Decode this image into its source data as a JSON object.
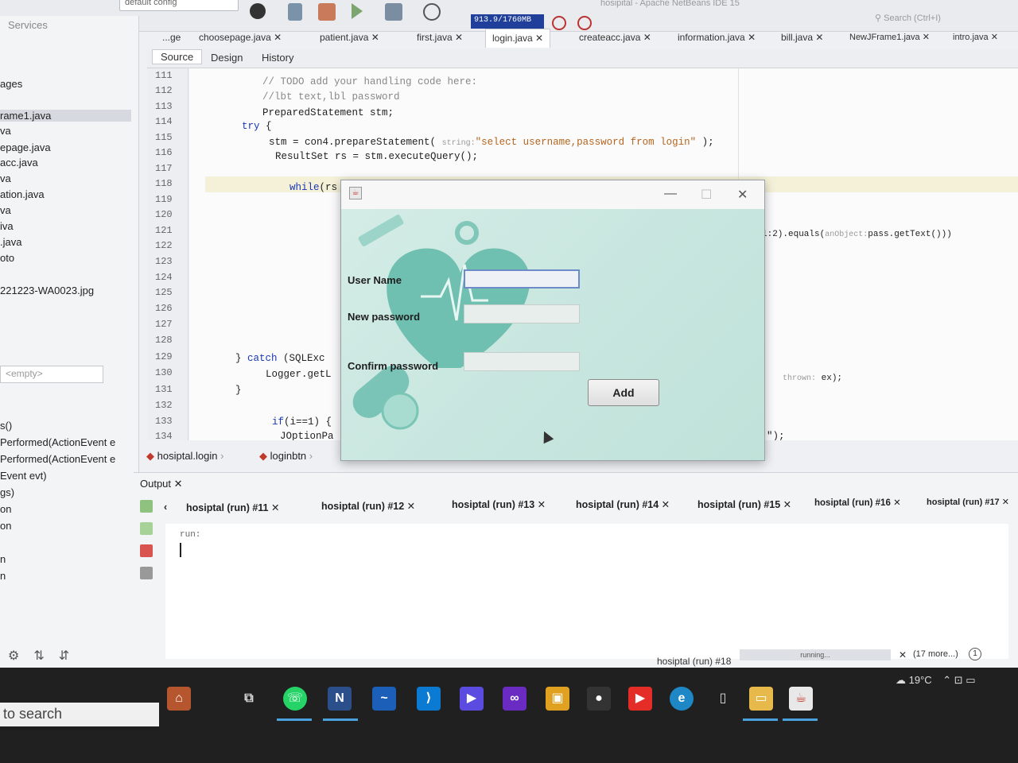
{
  "toolbar": {
    "config_select": "default config",
    "memory": "913.9/1760MB",
    "app_title": "hosipital - Apache NetBeans IDE 15",
    "search_placeholder": "Search (Ctrl+I)"
  },
  "left_panel": {
    "services": "Services",
    "items": [
      "ages",
      "rame1.java",
      "va",
      "epage.java",
      "acc.java",
      "va",
      "ation.java",
      "va",
      "iva",
      ".java",
      "oto",
      "221223-WA0023.jpg"
    ],
    "navigator_select": "<empty>",
    "members": [
      "s()",
      "Performed(ActionEvent e",
      "Performed(ActionEvent e",
      "Event evt)",
      "gs)",
      "on",
      "on",
      "n",
      "n"
    ]
  },
  "editor": {
    "tabs": [
      "...ge",
      "choosepage.java",
      "patient.java",
      "first.java",
      "login.java",
      "createacc.java",
      "information.java",
      "bill.java",
      "NewJFrame1.java",
      "intro.java"
    ],
    "active_tab": "login.java",
    "view_tabs": [
      "Source",
      "Design",
      "History"
    ],
    "line_numbers": [
      "111",
      "112",
      "113",
      "114",
      "115",
      "116",
      "117",
      "118",
      "119",
      "120",
      "121",
      "122",
      "123",
      "124",
      "125",
      "126",
      "127",
      "128",
      "129",
      "130",
      "131",
      "132",
      "133",
      "134"
    ],
    "code": {
      "l111": "// TODO add your handling code here:",
      "l112": "//lbt text,lbl password",
      "l113": "PreparedStatement stm;",
      "l114_kw": "try",
      "l114_rest": " {",
      "l115_a": "stm = con4.prepareStatement(",
      "l115_hint": "string:",
      "l115_str": "\"select username,password from login\"",
      "l115_b": ");",
      "l116": "ResultSet rs = stm.executeQuery();",
      "l118_kw": "while",
      "l118_rest": "(rs",
      "l121_a": "1:2).equals(",
      "l121_hint": "anObject:",
      "l121_b": "pass.getText()))",
      "l129_a": "} ",
      "l129_kw": "catch",
      "l129_b": " (SQLExc",
      "l130": "Logger.getL",
      "l130_right_hint": "thrown:",
      "l130_right": " ex);",
      "l131": "}",
      "l133_kw": "if",
      "l133_rest": "(i==1) {",
      "l134": "JOptionPa",
      "l134_right": "\");"
    }
  },
  "breadcrumbs": [
    "hosiptal.login",
    "loginbtn"
  ],
  "output": {
    "title": "Output",
    "tabs": [
      "hosiptal (run) #11",
      "hosiptal (run) #12",
      "hosiptal (run) #13",
      "hosiptal (run) #14",
      "hosiptal (run) #15",
      "hosiptal (run) #16",
      "hosiptal (run) #17"
    ],
    "console": "run:"
  },
  "status": {
    "process": "hosiptal (run) #18",
    "progress_label": "running...",
    "more": "(17 more...)",
    "notifications": "1"
  },
  "dialog": {
    "label_username": "User Name",
    "label_newpass": "New password",
    "label_confirm": "Confirm password",
    "add_button": "Add",
    "username_value": "",
    "newpass_value": "",
    "confirm_value": ""
  },
  "taskbar": {
    "search": "to search",
    "weather": "19°C"
  },
  "colors": {
    "dialog_bg": "#c8e6df",
    "heart": "#5fb8a8",
    "memory_bar": "#1f3f9a"
  }
}
